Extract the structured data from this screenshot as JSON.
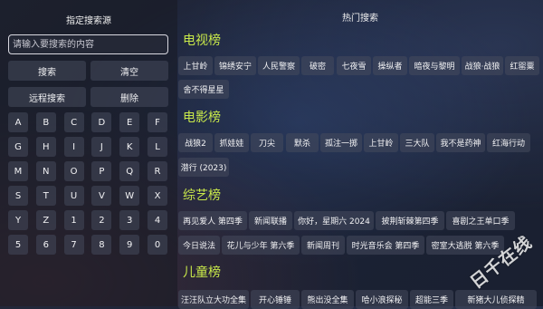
{
  "left_panel": {
    "title": "指定搜索源",
    "search_placeholder": "请输入要搜索的内容",
    "search_button": "搜索",
    "clear_button": "清空",
    "remote_search_button": "远程搜索",
    "delete_button": "删除",
    "keys": [
      "A",
      "B",
      "C",
      "D",
      "E",
      "F",
      "G",
      "H",
      "I",
      "J",
      "K",
      "L",
      "M",
      "N",
      "O",
      "P",
      "Q",
      "R",
      "S",
      "T",
      "U",
      "V",
      "W",
      "X",
      "Y",
      "Z",
      "1",
      "2",
      "3",
      "4",
      "5",
      "6",
      "7",
      "8",
      "9",
      "0"
    ]
  },
  "right_panel": {
    "title": "热门搜索",
    "categories": [
      {
        "name": "电视榜",
        "items": [
          "上甘岭",
          "锦绣安宁",
          "人民警察",
          "破密",
          "七夜雪",
          "操纵者",
          "暗夜与黎明",
          "战狼·战狼",
          "红罂粟",
          "舍不得星星"
        ]
      },
      {
        "name": "电影榜",
        "items": [
          "战狼2",
          "抓娃娃",
          "刀尖",
          "默杀",
          "孤注一掷",
          "上甘岭",
          "三大队",
          "我不是药神",
          "红海行动",
          "潜行 (2023)"
        ]
      },
      {
        "name": "综艺榜",
        "items": [
          "再见爱人 第四季",
          "新闻联播",
          "你好，星期六 2024",
          "披荆斩棘第四季",
          "喜剧之王单口季",
          "今日说法",
          "花儿与少年 第六季",
          "新闻周刊",
          "时光音乐会 第四季",
          "密室大逃脱 第六季"
        ]
      },
      {
        "name": "儿童榜",
        "items": [
          "汪汪队立大功全集",
          "开心锤锤",
          "熊出没全集",
          "哈小浪探秘",
          "超能三季",
          "新猪大儿侦探精"
        ]
      }
    ]
  },
  "watermark": "日千在线"
}
